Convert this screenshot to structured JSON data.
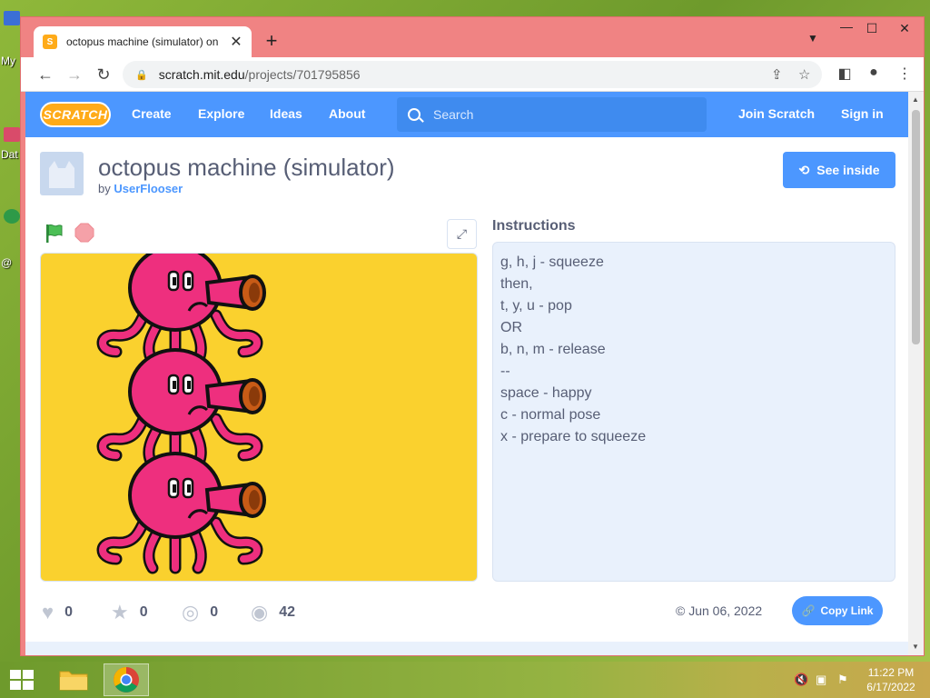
{
  "desktop": {
    "icon_labels": [
      "My",
      "Dat",
      "@"
    ]
  },
  "browser": {
    "tab_title": "octopus machine (simulator) on S",
    "tab_favicon": "scratch-icon",
    "new_tab": "+",
    "url_host": "scratch.mit.edu",
    "url_path": "/projects/701795856",
    "window_controls": {
      "minimize": "—",
      "maximize": "☐",
      "close": "✕"
    }
  },
  "scratch_nav": {
    "logo": "SCRATCH",
    "links": [
      "Create",
      "Explore",
      "Ideas",
      "About"
    ],
    "search_placeholder": "Search",
    "join": "Join Scratch",
    "signin": "Sign in"
  },
  "project": {
    "title": "octopus machine (simulator)",
    "by_prefix": "by",
    "author": "UserFlooser",
    "see_inside": "See inside",
    "instructions_heading": "Instructions",
    "instructions": [
      "g, h, j - squeeze",
      "then,",
      "t, y, u - pop",
      "OR",
      "b, n, m - release",
      "--",
      "space - happy",
      "c - normal pose",
      "x - prepare to squeeze"
    ],
    "stats": {
      "loves": "0",
      "favorites": "0",
      "remixes": "0",
      "views": "42"
    },
    "date": "© Jun 06, 2022",
    "copy_link": "Copy Link"
  },
  "colors": {
    "scratch_blue": "#4c97ff",
    "stage_yellow": "#fad12e",
    "octopus_pink": "#ee2f7e",
    "window_frame": "#f08383"
  },
  "taskbar": {
    "time": "11:22 PM",
    "date": "6/17/2022"
  }
}
